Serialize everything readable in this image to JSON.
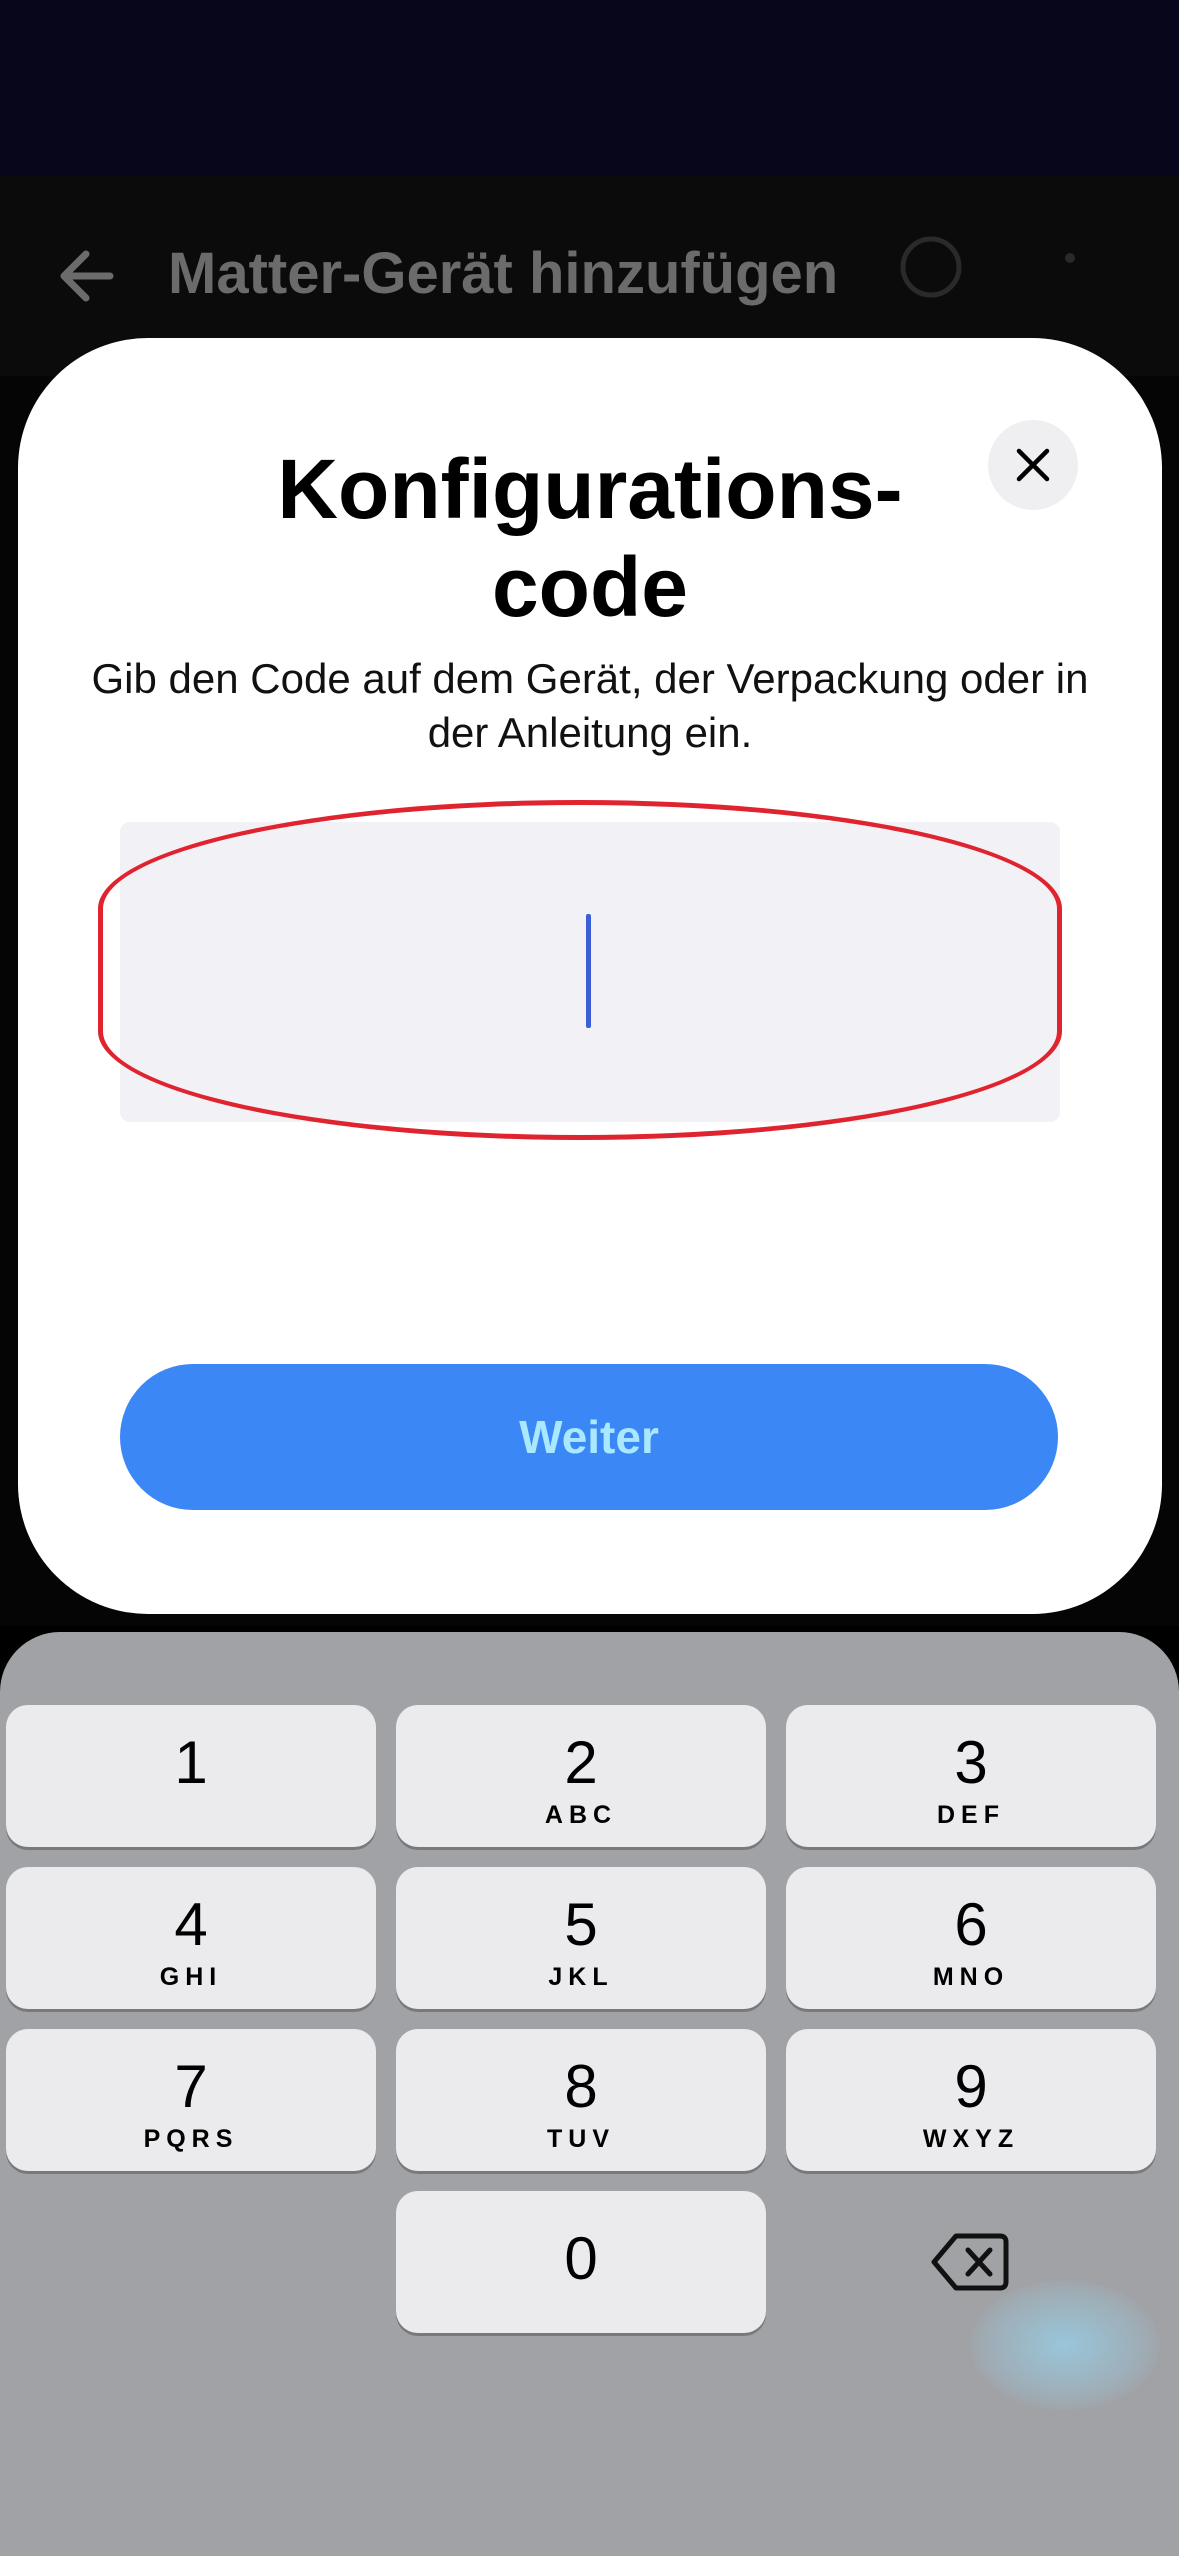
{
  "app_bar": {
    "title": "Matter-Gerät hinzufügen",
    "back_icon": "arrow-left-icon",
    "help_icon": "help-circle-icon",
    "more_icon": "more-vertical-icon"
  },
  "sheet": {
    "title": "Konfigurations-\ncode",
    "description": "Gib den Code auf dem Gerät, der Verpackung oder in der Anleitung ein.",
    "code_input_value": "",
    "close_icon": "close-icon",
    "continue_label": "Weiter"
  },
  "keyboard": {
    "keys": [
      {
        "num": "1",
        "letters": ""
      },
      {
        "num": "2",
        "letters": "ABC"
      },
      {
        "num": "3",
        "letters": "DEF"
      },
      {
        "num": "4",
        "letters": "GHI"
      },
      {
        "num": "5",
        "letters": "JKL"
      },
      {
        "num": "6",
        "letters": "MNO"
      },
      {
        "num": "7",
        "letters": "PQRS"
      },
      {
        "num": "8",
        "letters": "TUV"
      },
      {
        "num": "9",
        "letters": "WXYZ"
      },
      {
        "num": "0",
        "letters": ""
      }
    ],
    "backspace_icon": "backspace-icon"
  },
  "colors": {
    "accent": "#3b87f5",
    "highlight_ring": "#e0242f",
    "cursor": "#3b5fd9",
    "keyboard_bg": "#a1a2a6"
  }
}
